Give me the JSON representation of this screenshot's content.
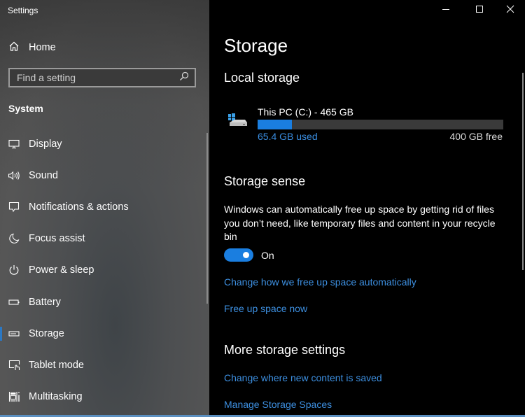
{
  "window": {
    "title": "Settings",
    "controls": {
      "minimize": "minimize-icon",
      "maximize": "maximize-icon",
      "close": "close-icon"
    }
  },
  "sidebar": {
    "home_label": "Home",
    "search": {
      "placeholder": "Find a setting",
      "value": ""
    },
    "section_label": "System",
    "items": [
      {
        "label": "Display",
        "icon": "display-icon"
      },
      {
        "label": "Sound",
        "icon": "sound-icon"
      },
      {
        "label": "Notifications & actions",
        "icon": "notifications-icon"
      },
      {
        "label": "Focus assist",
        "icon": "moon-icon"
      },
      {
        "label": "Power & sleep",
        "icon": "power-icon"
      },
      {
        "label": "Battery",
        "icon": "battery-icon"
      },
      {
        "label": "Storage",
        "icon": "storage-icon",
        "selected": true
      },
      {
        "label": "Tablet mode",
        "icon": "tablet-mode-icon"
      },
      {
        "label": "Multitasking",
        "icon": "multitasking-icon"
      }
    ]
  },
  "main": {
    "title": "Storage",
    "local_storage": {
      "heading": "Local storage",
      "drive": {
        "name": "This PC (C:) - 465 GB",
        "used_label": "65.4 GB used",
        "free_label": "400 GB free",
        "used_fraction": 0.14,
        "icon": "drive-icon"
      }
    },
    "storage_sense": {
      "heading": "Storage sense",
      "description": "Windows can automatically free up space by getting rid of files you don’t need, like temporary files and content in your recycle bin",
      "toggle": {
        "state": true,
        "label": "On"
      },
      "links": [
        "Change how we free up space automatically",
        "Free up space now"
      ]
    },
    "more_settings": {
      "heading": "More storage settings",
      "links": [
        "Change where new content is saved",
        "Manage Storage Spaces"
      ]
    }
  },
  "colors": {
    "accent": "#1a7ee0",
    "link": "#3d8fe0",
    "bar_track": "#3a3a3a"
  }
}
